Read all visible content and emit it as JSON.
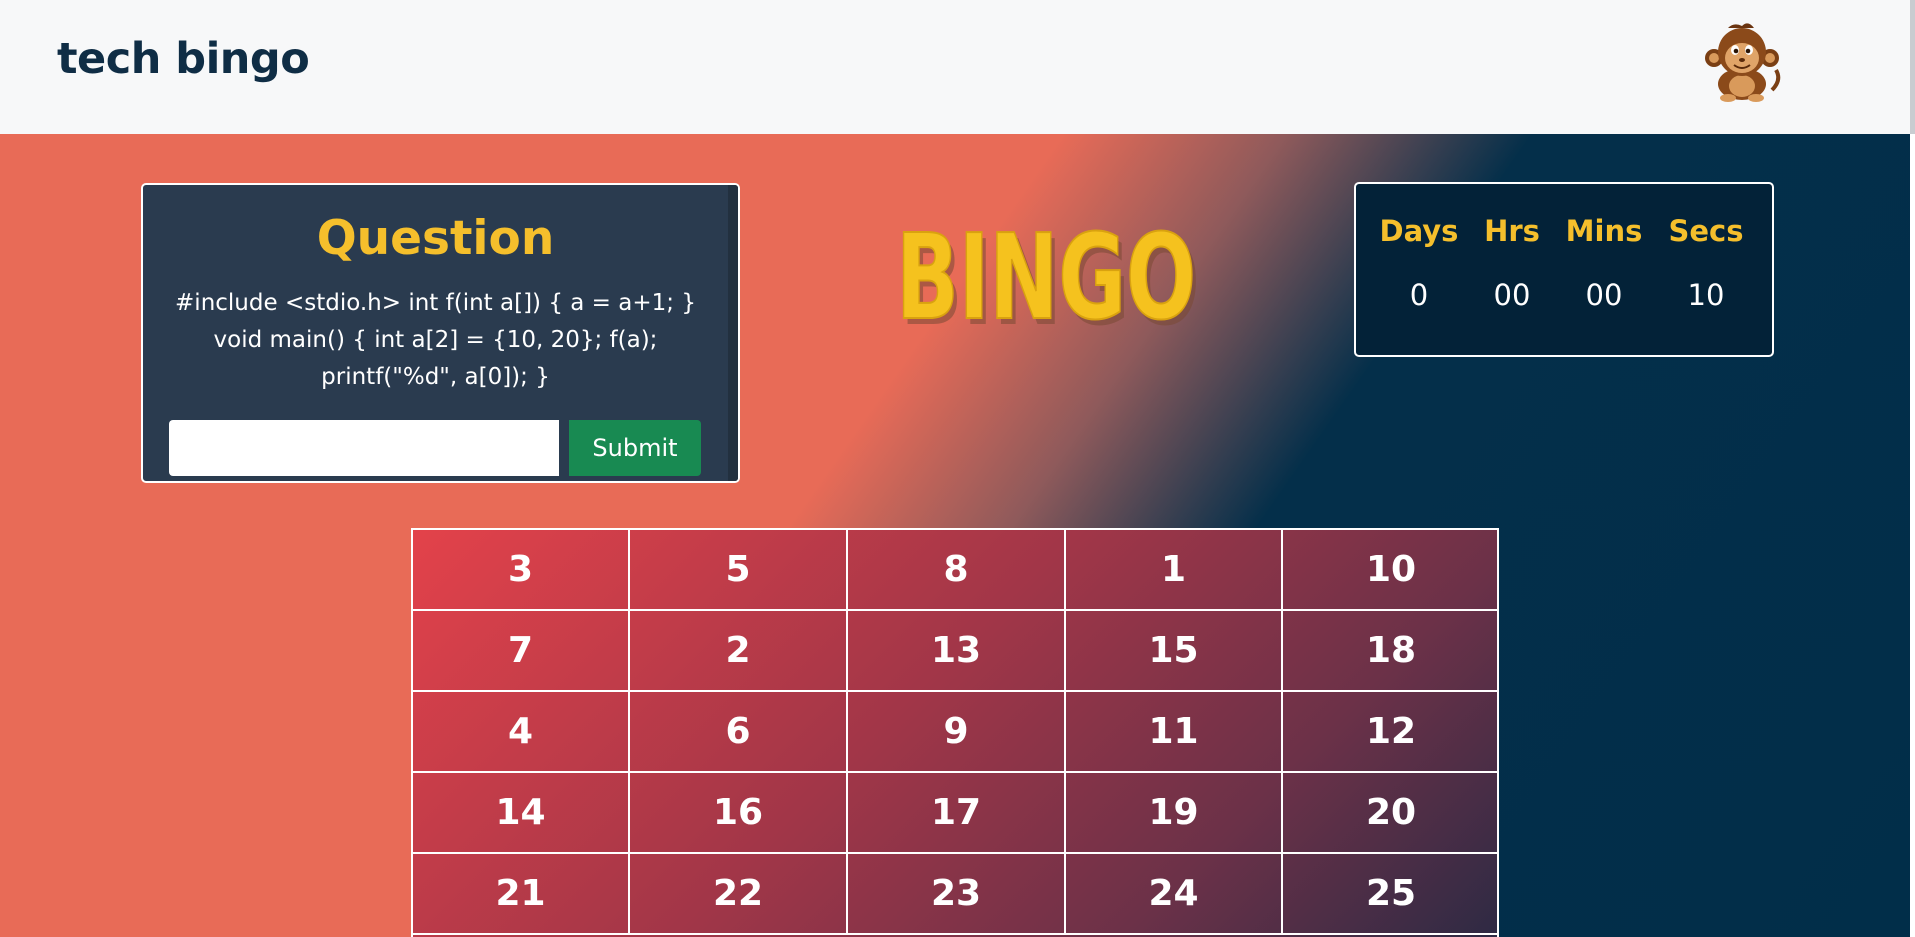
{
  "navbar": {
    "brand": "tech bingo",
    "avatar_icon": "monkey-avatar-icon"
  },
  "question": {
    "title": "Question",
    "code": "#include <stdio.h> int f(int a[]) { a = a+1; } void main() { int a[2] = {10, 20}; f(a); printf(\"%d\", a[0]); }",
    "answer_value": "",
    "submit_label": "Submit"
  },
  "logo": {
    "text": "BINGO",
    "color": "#f5c21e"
  },
  "timer": {
    "labels": [
      "Days",
      "Hrs",
      "Mins",
      "Secs"
    ],
    "values": [
      "0",
      "00",
      "00",
      "10"
    ]
  },
  "board": {
    "rows": [
      [
        "3",
        "5",
        "8",
        "1",
        "10"
      ],
      [
        "7",
        "2",
        "13",
        "15",
        "18"
      ],
      [
        "4",
        "6",
        "9",
        "11",
        "12"
      ],
      [
        "14",
        "16",
        "17",
        "19",
        "20"
      ],
      [
        "21",
        "22",
        "23",
        "24",
        "25"
      ]
    ]
  },
  "colors": {
    "accent_yellow": "#f5bf2c",
    "submit_green": "#188a52",
    "coral": "#e86b57",
    "navy": "#012e49"
  }
}
